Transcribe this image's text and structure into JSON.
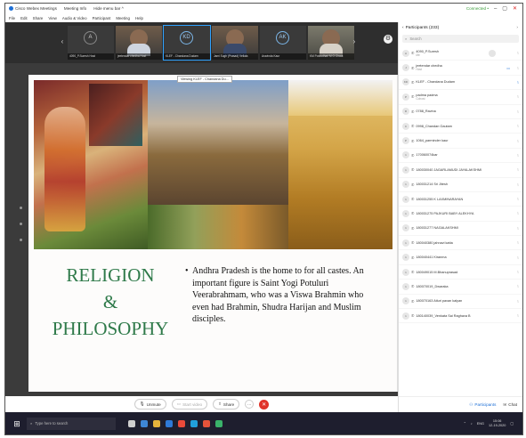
{
  "window": {
    "title": "Cisco Webex Meetings",
    "menu_tabs": [
      "Meeting Info",
      "Hide menu bar ^"
    ],
    "connection": "Connected •",
    "min": "–",
    "max": "▢",
    "close": "✕"
  },
  "menu": [
    "File",
    "Edit",
    "Share",
    "View",
    "Audio & Video",
    "Participant",
    "Meeting",
    "Help"
  ],
  "video_strip": {
    "tiles": [
      {
        "initials": "A",
        "caption": "4090_P.Suresh Host"
      },
      {
        "initials": "",
        "caption": "jeetendar chedha Host"
      },
      {
        "initials": "KD",
        "caption": "KLEF - Chandana Dudam"
      },
      {
        "initials": "",
        "caption": "Jami Sugh (Prasad) Vellala"
      },
      {
        "initials": "AK",
        "caption": "Aravinda Kaur"
      },
      {
        "initials": "",
        "caption": "KM Potoudhari M O Chaut"
      }
    ]
  },
  "viewing_label": "Viewing KLEF - Chandana Du...",
  "slide": {
    "heading_1": "RELIGION",
    "heading_2": "&",
    "heading_3": "PHILOSOPHY",
    "bullet": "Andhra Pradesh is the home to for all castes. An important figure is Saint Yogi Potuluri Veerabrahmam, who was a Viswa Brahmin who even had Brahmin, Shudra Harijan and Muslim disciples."
  },
  "controls": {
    "unmute": "Unmute",
    "start_video": "Start video",
    "share": "Share",
    "more": "···",
    "end": "✕"
  },
  "participants": {
    "title": "Participants (233)",
    "search_placeholder": "Search",
    "list": [
      {
        "name": "4090_P.Suresh",
        "sub": "Me",
        "avatar": "A"
      },
      {
        "name": "jeetendar chedha",
        "sub": "Host",
        "avatar": "J"
      },
      {
        "name": "KLEF - Chandana Dudam",
        "sub": "",
        "avatar": "KD"
      },
      {
        "name": "padma padma",
        "sub": "Cohost",
        "avatar": "P"
      },
      {
        "name": "0788_Ravina",
        "sub": "",
        "avatar": "R"
      },
      {
        "name": "0998_Chandan Gautam",
        "sub": "",
        "avatar": "C"
      },
      {
        "name": "1064_parminder kaur",
        "sub": "",
        "avatar": "P"
      },
      {
        "name": "170060074kar",
        "sub": "",
        "avatar": "1"
      },
      {
        "name": "180030040 JAGARLAMUDI JAYALAKSHMI",
        "sub": "",
        "avatar": "1"
      },
      {
        "name": "180031214 Sri Jitesh",
        "sub": "",
        "avatar": "1"
      },
      {
        "name": "180031255 K LAXMINARAYAN",
        "sub": "",
        "avatar": "1"
      },
      {
        "name": "180031275 PAJKURI BABY ALEKHYA",
        "sub": "",
        "avatar": "1"
      },
      {
        "name": "180031277 NAGALAKSHMI",
        "sub": "",
        "avatar": "1"
      },
      {
        "name": "180040380 jahnavi katta",
        "sub": "",
        "avatar": "1"
      },
      {
        "name": "180040441 Kiranma",
        "sub": "",
        "avatar": "1"
      },
      {
        "name": "180049015 M.Bhanuprasad",
        "sub": "",
        "avatar": "1"
      },
      {
        "name": "180070019_Dwaraka",
        "sub": "",
        "avatar": "1"
      },
      {
        "name": "180070163 Atluri pavan kalyan",
        "sub": "",
        "avatar": "1"
      },
      {
        "name": "180140039_Venkata Sai Raghava B",
        "sub": "",
        "avatar": "1"
      }
    ],
    "footer_participants": "Participants",
    "footer_chat": "Chat"
  },
  "taskbar": {
    "search": "Type here to search",
    "tray_lang": "ENG",
    "time": "15:06",
    "date": "12-19-2020"
  }
}
